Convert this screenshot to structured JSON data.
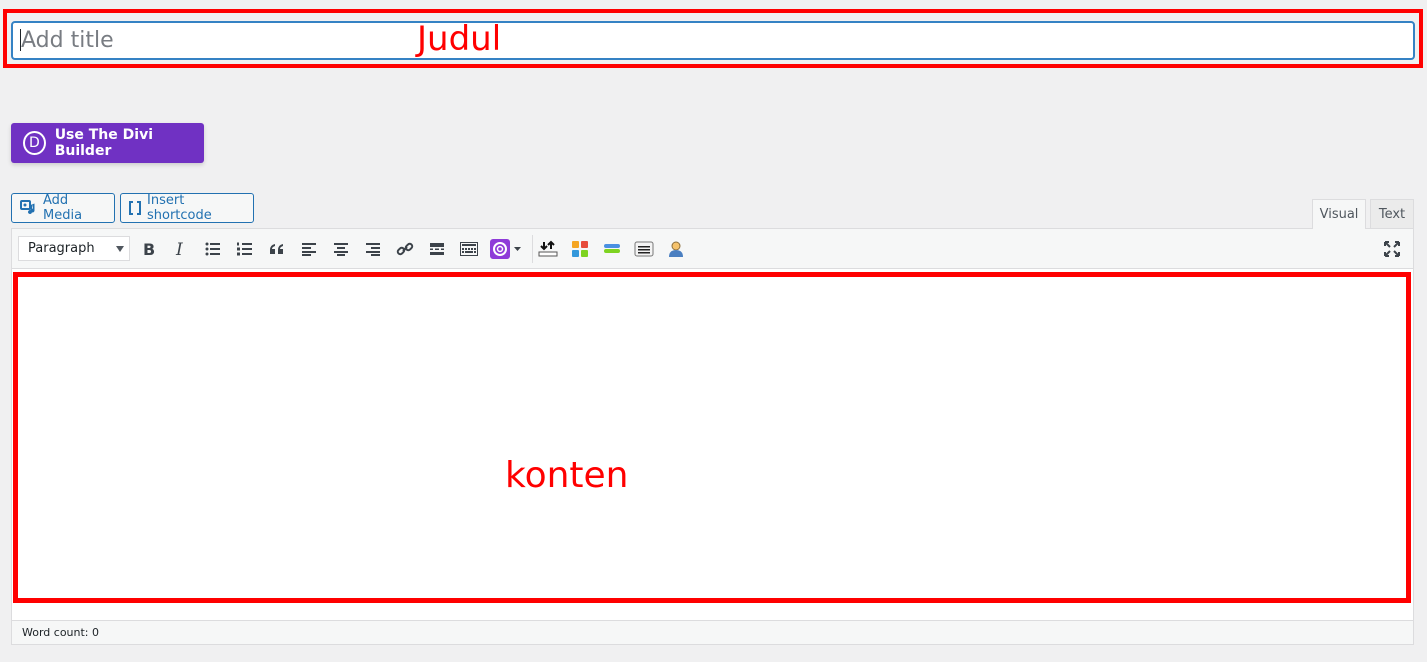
{
  "title": {
    "placeholder": "Add title",
    "annotation": "Judul"
  },
  "divi": {
    "logo_letter": "D",
    "label": "Use The Divi Builder",
    "color": "#7031c3"
  },
  "media_buttons": {
    "add_media": "Add Media",
    "insert_shortcode": "Insert shortcode"
  },
  "tabs": {
    "visual": "Visual",
    "text": "Text",
    "active": "Visual"
  },
  "toolbar": {
    "format": "Paragraph",
    "buttons": [
      "bold-icon",
      "italic-icon",
      "bullet-list-icon",
      "numbered-list-icon",
      "blockquote-icon",
      "align-left-icon",
      "align-center-icon",
      "align-right-icon",
      "link-icon",
      "read-more-icon",
      "toolbar-toggle-icon",
      "divi-layout-icon",
      "download-icon",
      "grid-icon",
      "divider-icon",
      "table-icon",
      "user-icon",
      "fullscreen-icon"
    ]
  },
  "content": {
    "annotation": "konten"
  },
  "status": {
    "word_count": "Word count: 0"
  },
  "colors": {
    "annotation": "#ff0000",
    "accent": "#2271b1",
    "background": "#f0f0f1"
  }
}
